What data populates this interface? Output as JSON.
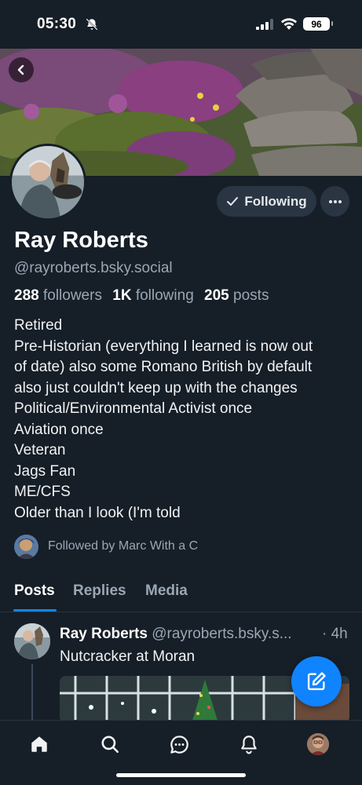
{
  "status_bar": {
    "time": "05:30",
    "battery": "96",
    "icons": [
      "bell-off-icon",
      "signal-icon",
      "wifi-icon",
      "battery-icon"
    ]
  },
  "profile": {
    "display_name": "Ray Roberts",
    "handle": "@rayroberts.bsky.social",
    "followers_count": "288",
    "followers_label": "followers",
    "following_count": "1K",
    "following_label": "following",
    "posts_count": "205",
    "posts_label": "posts",
    "bio_lines": [
      "Retired",
      "Pre-Historian (everything I learned is now out",
      "of date) also some Romano British by default",
      "also just couldn't keep up with the changes",
      "Political/Environmental Activist once",
      "Aviation once",
      "Veteran",
      "Jags Fan",
      "ME/CFS",
      "Older than I look (I'm told"
    ],
    "followed_by": "Followed by Marc With a C",
    "following_button_label": "Following"
  },
  "tabs": [
    {
      "label": "Posts",
      "active": true
    },
    {
      "label": "Replies",
      "active": false
    },
    {
      "label": "Media",
      "active": false
    }
  ],
  "post": {
    "author": "Ray Roberts",
    "handle": "@rayroberts.bsky.s...",
    "time": "· 4h",
    "text": "Nutcracker at Moran"
  },
  "nav": [
    "home-icon",
    "search-icon",
    "chat-icon",
    "notifications-icon",
    "profile-avatar"
  ],
  "colors": {
    "background": "#161e27",
    "accent": "#1083fe",
    "muted_text": "#9aa7b4",
    "button_bg": "#2a3543"
  }
}
